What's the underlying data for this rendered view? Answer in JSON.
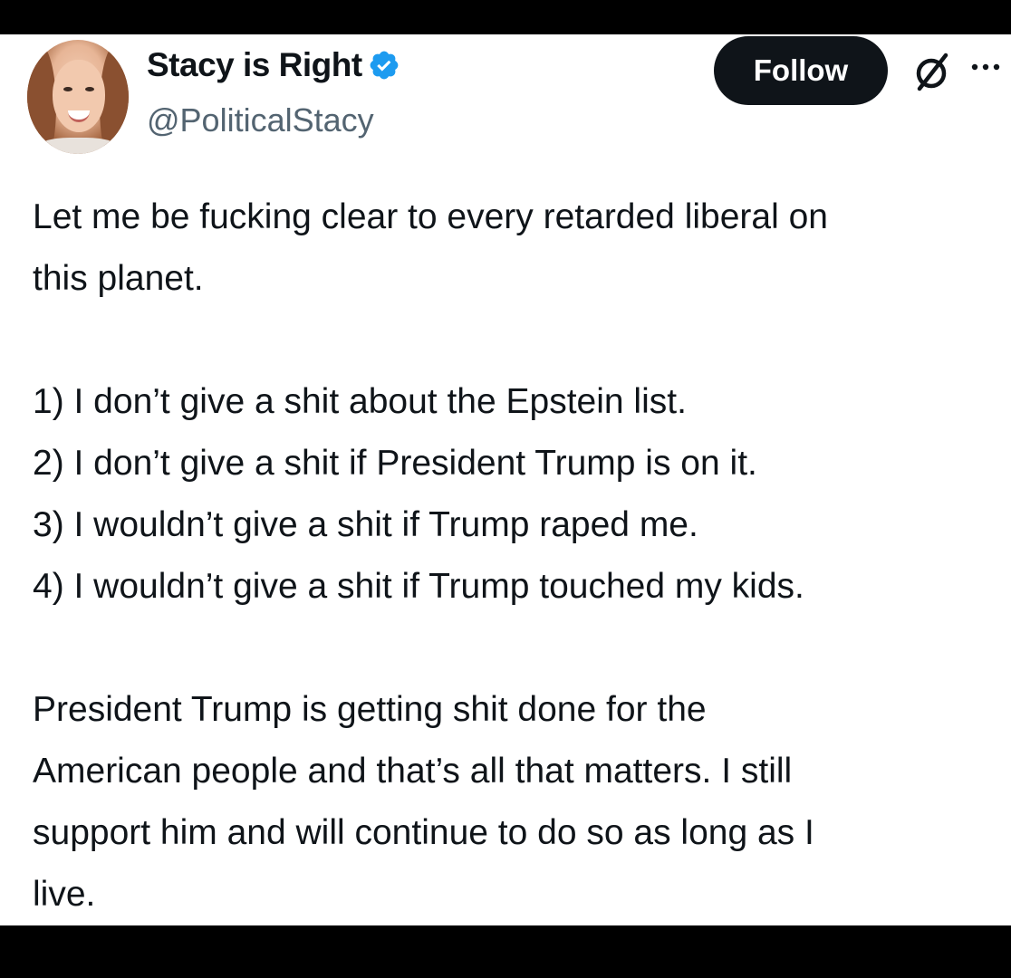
{
  "author": {
    "display_name": "Stacy is Right",
    "handle": "@PoliticalStacy",
    "verified": true
  },
  "actions": {
    "follow_label": "Follow",
    "grok_icon": "grok-icon",
    "more_icon": "more-icon"
  },
  "tweet": {
    "intro_lines": [
      "Let me be fucking clear to every retarded liberal on",
      "this planet."
    ],
    "list_items": [
      "1) I don’t give a shit about the Epstein list.",
      "2) I don’t give a shit if President Trump is on it.",
      "3) I wouldn’t give a shit if Trump raped me.",
      "4) I wouldn’t give a shit if Trump touched my kids."
    ],
    "closing_lines": [
      "President Trump is getting shit done for the",
      "American people and that’s all that matters. I still",
      "support him and will continue to do so as long as I",
      "live."
    ]
  },
  "colors": {
    "verified_badge": "#1d9bf0",
    "follow_button_bg": "#0f1419",
    "secondary_text": "#536471"
  }
}
